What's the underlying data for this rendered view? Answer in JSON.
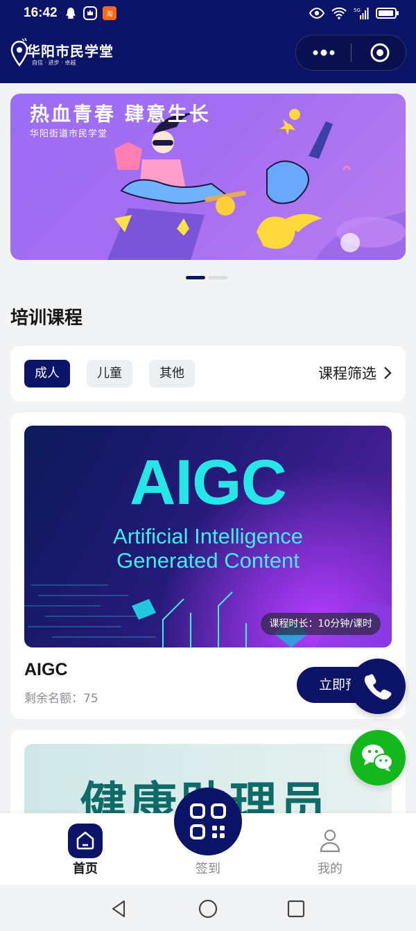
{
  "status_bar": {
    "time": "16:42",
    "network": "5G"
  },
  "header": {
    "logo_title": "华阳市民学堂",
    "logo_sub": "自信 · 进步 · 卓越",
    "capsule_more": "more-options",
    "capsule_close": "close-miniprogram"
  },
  "banner": {
    "title": "热血青春 肆意生长",
    "subtitle": "华阳街道市民学堂",
    "page_count": 2,
    "active_page": 1
  },
  "section": {
    "title": "培训课程"
  },
  "filters": {
    "chips": [
      "成人",
      "儿童",
      "其他"
    ],
    "active": "成人",
    "filter_link": "课程筛选"
  },
  "course1": {
    "image_big": "AIGC",
    "image_line1": "Artificial Intelligence",
    "image_line2": "Generated Content",
    "duration": "课程时长：10分钟/课时",
    "name": "AIGC",
    "quota": "剩余名额：75",
    "button": "立即预约"
  },
  "course2": {
    "image_title": "健康助理员"
  },
  "tabbar": {
    "home": "首页",
    "checkin": "签到",
    "mine": "我的"
  },
  "colors": {
    "primary": "#0c1467",
    "wechat": "#14b81e",
    "page_bg": "#f2f3f5"
  }
}
